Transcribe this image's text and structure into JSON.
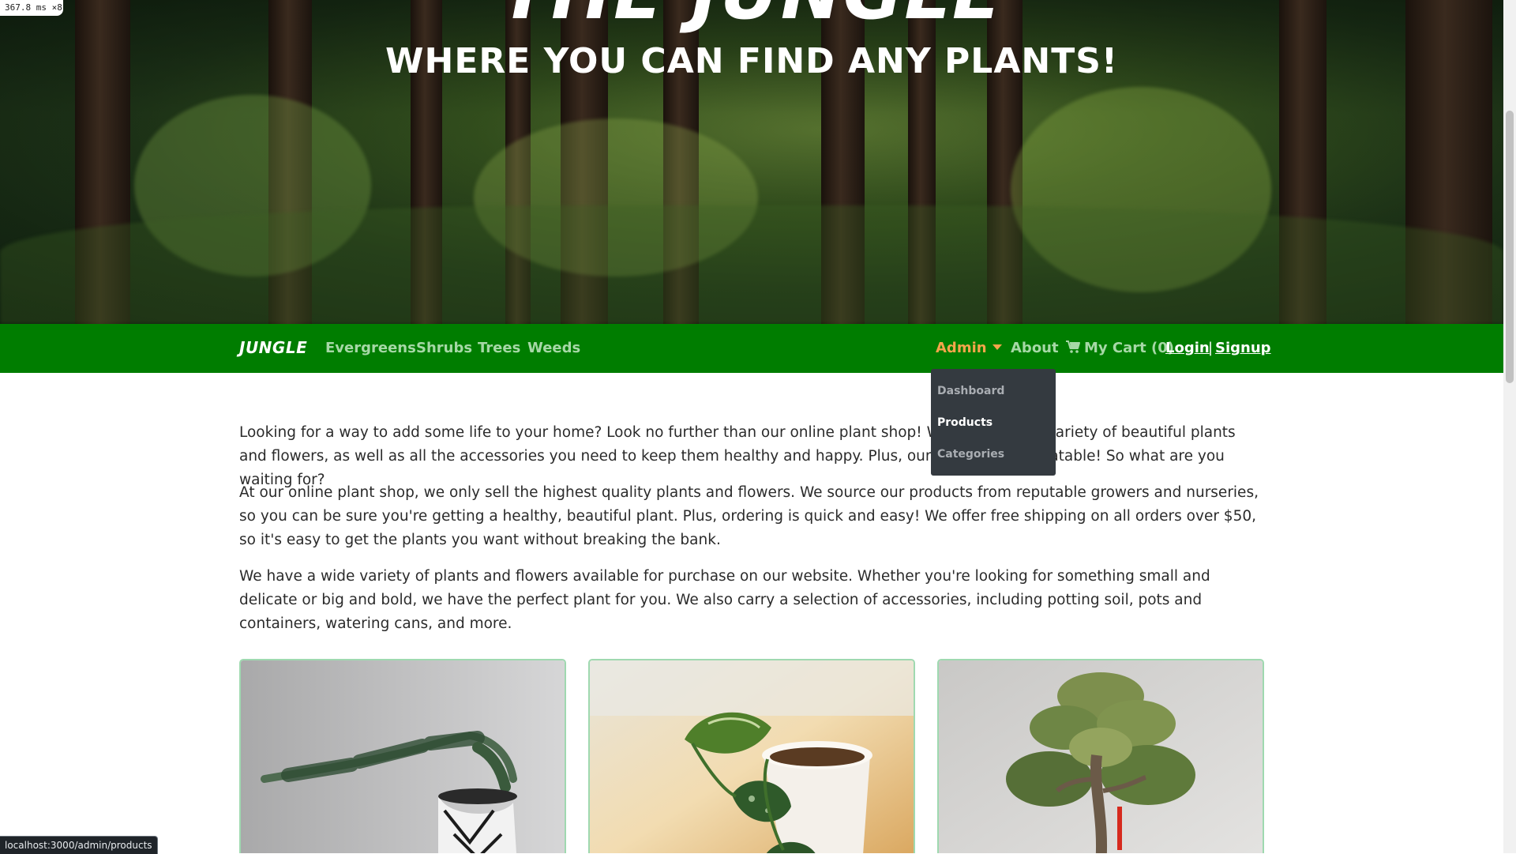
{
  "overlay": {
    "fps": "367.8 ms ×8"
  },
  "hero": {
    "title": "THE JUNGLE",
    "subtitle": "WHERE YOU CAN FIND ANY PLANTS!"
  },
  "nav": {
    "brand": "JUNGLE",
    "categories": [
      "Evergreens",
      "Shrubs",
      "Trees",
      "Weeds"
    ],
    "admin": "Admin",
    "about": "About",
    "cart": "My Cart (0)",
    "login": "Login",
    "separator": "|",
    "signup": "Signup"
  },
  "admin_menu": {
    "items": [
      "Dashboard",
      "Products",
      "Categories"
    ],
    "active": "Products"
  },
  "content": {
    "paragraphs": [
      "Looking for a way to add some life to your home? Look no further than our online plant shop! We have a wide variety of beautiful plants and flowers, as well as all the accessories you need to keep them healthy and happy. Plus, our prices are unbeatable! So what are you waiting for?",
      "At our online plant shop, we only sell the highest quality plants and flowers. We source our products from reputable growers and nurseries, so you can be sure you're getting a healthy, beautiful plant. Plus, ordering is quick and easy! We offer free shipping on all orders over $50, so it's easy to get the plants you want without breaking the bank.",
      "We have a wide variety of plants and flowers available for purchase on our website. Whether you're looking for something small and delicate or big and bold, we have the perfect plant for you. We also carry a selection of accessories, including potting soil, pots and containers, watering cans, and more."
    ]
  },
  "products": [
    {
      "image": "juniper-bonsai-in-patterned-pot"
    },
    {
      "image": "pothos-in-white-pot"
    },
    {
      "image": "bonsai-tree"
    }
  ],
  "status_bar": {
    "url": "localhost:3000/admin/products"
  },
  "colors": {
    "nav_bg": "#007d00",
    "nav_link": "#a6d8a6",
    "admin_link": "#f6a54b",
    "dropdown_bg": "#343a40",
    "card_border": "#9fd9b0"
  }
}
